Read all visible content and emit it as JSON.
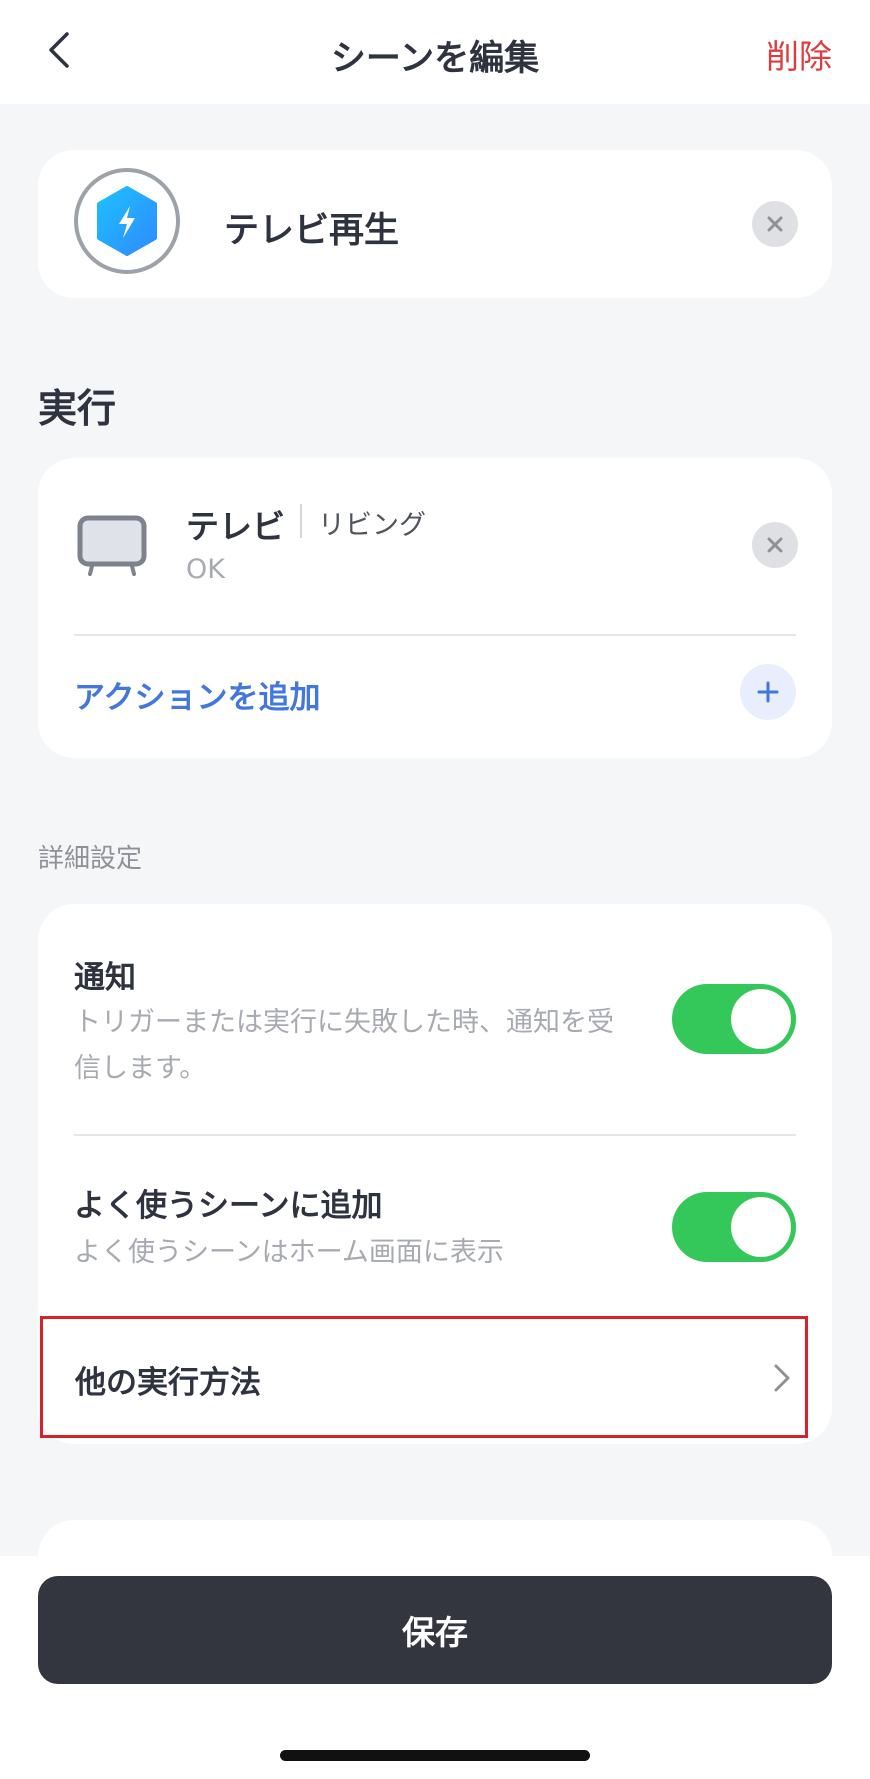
{
  "header": {
    "title": "シーンを編集",
    "delete_label": "削除"
  },
  "scene": {
    "name": "テレビ再生",
    "icon": "lightning-hexagon-icon"
  },
  "execution": {
    "section_title": "実行",
    "action": {
      "device": "テレビ",
      "room": "リビング",
      "state": "OK",
      "icon": "tv-icon"
    },
    "add_action_label": "アクションを追加"
  },
  "advanced": {
    "section_label": "詳細設定",
    "notification": {
      "title": "通知",
      "description": "トリガーまたは実行に失敗した時、通知を受信します。",
      "enabled": true
    },
    "favorites": {
      "title": "よく使うシーンに追加",
      "description": "よく使うシーンはホーム画面に表示",
      "enabled": true
    },
    "other_methods_label": "他の実行方法"
  },
  "footer": {
    "save_label": "保存"
  },
  "colors": {
    "accent_blue": "#4377dd",
    "delete_red": "#de3d3d",
    "toggle_on": "#34c759",
    "save_button": "#33353f",
    "highlight_border": "#d4232b"
  }
}
